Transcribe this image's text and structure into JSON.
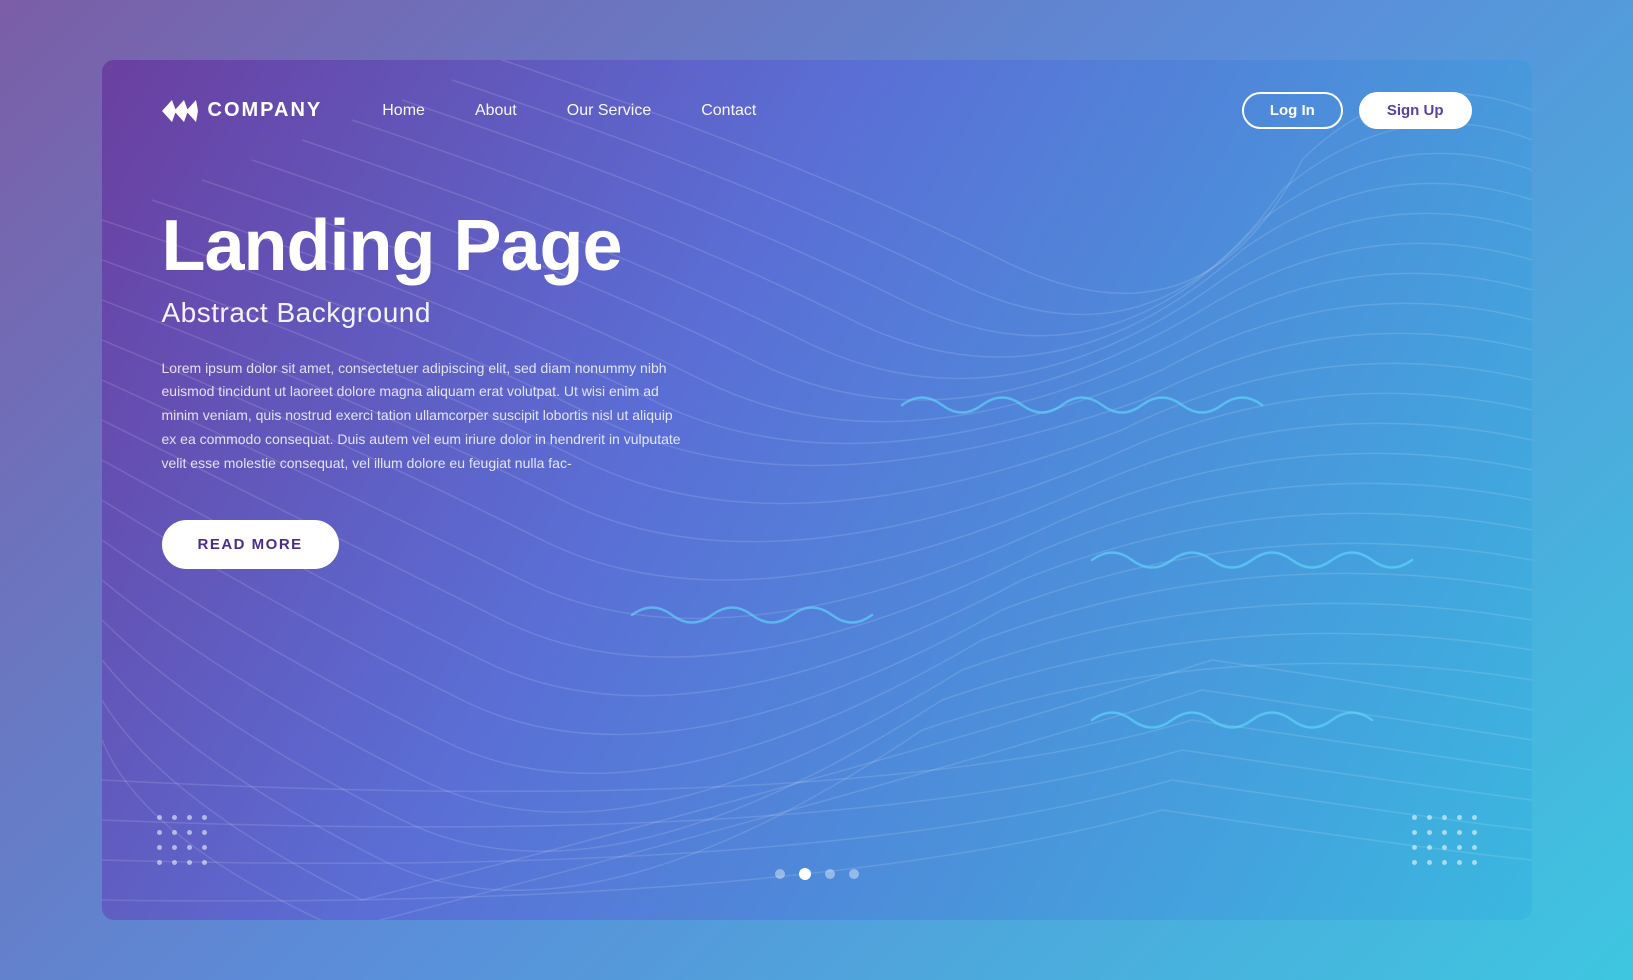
{
  "page": {
    "title": "Landing Page",
    "subtitle": "Abstract Background",
    "body_text": "Lorem ipsum dolor sit amet, consectetuer adipiscing elit, sed diam nonummy nibh euismod tincidunt ut laoreet dolore magna aliquam erat volutpat. Ut wisi enim ad minim veniam, quis nostrud exerci tation ullamcorper suscipit lobortis nisl ut aliquip ex ea commodo consequat. Duis autem vel eum iriure dolor in hendrerit in vulputate velit esse molestie consequat, vel illum dolore eu feugiat nulla fac-"
  },
  "navbar": {
    "logo_text": "COMPANY",
    "logo_icon": "«»",
    "links": [
      {
        "label": "Home",
        "name": "nav-home"
      },
      {
        "label": "About",
        "name": "nav-about"
      },
      {
        "label": "Our Service",
        "name": "nav-service"
      },
      {
        "label": "Contact",
        "name": "nav-contact"
      }
    ],
    "login_label": "Log In",
    "signup_label": "Sign Up"
  },
  "cta": {
    "read_more_label": "READ MORE"
  },
  "pagination": {
    "dots": [
      {
        "active": false
      },
      {
        "active": true
      },
      {
        "active": false
      },
      {
        "active": false
      }
    ]
  },
  "colors": {
    "bg_start": "#6a3fa0",
    "bg_mid": "#5a6fd6",
    "bg_end": "#3ab8e0",
    "outer_bg": "#7b5ea7"
  }
}
